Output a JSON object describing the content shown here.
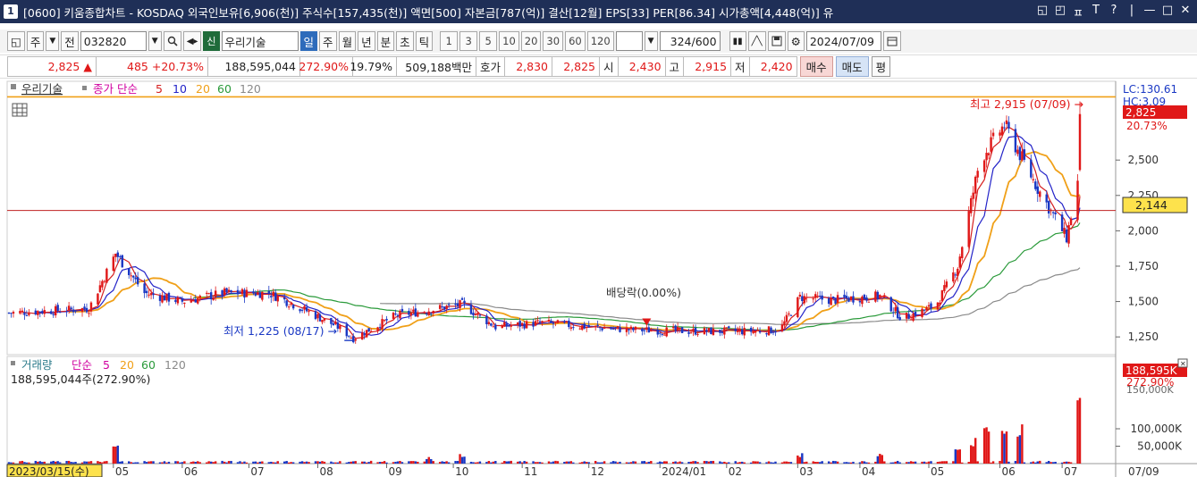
{
  "window": {
    "number": "1",
    "title": "[0600] 키움종합차트 - KOSDAQ 외국인보유[6,906(천)] 주식수[157,435(천)] 액면[500] 자본금[787(억)] 결산[12월] EPS[33] PER[86.34] 시가총액[4,448(억)] 유",
    "controls": [
      "◱",
      "◰",
      "ㅍ",
      "T",
      "?",
      "|",
      "—",
      "□",
      "✕"
    ]
  },
  "toolbar": {
    "period_unit": "주",
    "all": "전",
    "code": "032820",
    "stock_name": "우리기술",
    "sin_badge": "신",
    "periods": [
      "일",
      "주",
      "월",
      "년",
      "분",
      "초",
      "틱"
    ],
    "selected_period": "일",
    "intervals": [
      "1",
      "3",
      "5",
      "10",
      "20",
      "30",
      "60",
      "120"
    ],
    "count": "324",
    "count_total": "/600",
    "date": "2024/07/09"
  },
  "quote": {
    "price": "2,825",
    "arrow": "▲",
    "change": "485",
    "change_pct": "+20.73%",
    "volume": "188,595,044",
    "volume_ratio": "272.90%",
    "turnover": "19.79%",
    "amount": "509,188백만",
    "hoga_label": "호가",
    "ask": "2,830",
    "bid": "2,825",
    "open_label": "시",
    "open": "2,430",
    "high_label": "고",
    "high": "2,915",
    "low_label": "저",
    "low": "2,420",
    "buy": "매수",
    "sell": "매도",
    "flat": "평"
  },
  "price_panel": {
    "legend_stock": "우리기술",
    "legend_type": "종가 단순",
    "ma_periods": [
      "5",
      "10",
      "20",
      "60",
      "120"
    ],
    "lc_label": "LC:130.61",
    "hc_label": "HC:3.09",
    "current_price_badge": "2,825",
    "current_pct": "20.73%",
    "crosshair_price": "2,144",
    "high_annotation": "최고 2,915 (07/09) →",
    "low_annotation": "최저 1,225 (08/17) →",
    "dividend_annotation": "배당락(0.00%)",
    "y_ticks": [
      "2,500",
      "2,250",
      "2,000",
      "1,750",
      "1,500",
      "1,250"
    ]
  },
  "volume_panel": {
    "legend_title": "거래량",
    "legend_type": "단순",
    "ma_periods": [
      "5",
      "20",
      "60",
      "120"
    ],
    "current_volume": "188,595,044주(272.90%)",
    "badge": "188,595K",
    "badge_pct": "272.90%",
    "badge_under": "150,000K",
    "y_ticks": [
      "100,000K",
      "50,000K"
    ]
  },
  "x_axis": {
    "start_label": "2023/03/15(수)",
    "months": [
      "05",
      "06",
      "07",
      "08",
      "09",
      "10",
      "11",
      "12",
      "2024/01",
      "02",
      "03",
      "04",
      "05",
      "06",
      "07"
    ],
    "end_label": "07/09"
  },
  "colors": {
    "up": "#e01818",
    "down": "#1a38c4",
    "ma5": "#d62020",
    "ma10": "#2323c8",
    "ma20": "#f0a018",
    "ma60": "#2a9a3a",
    "ma120": "#8a8a8a"
  },
  "chart_data": {
    "type": "candlestick",
    "price_range": [
      1150,
      3000
    ],
    "high": {
      "value": 2915,
      "date": "07/09"
    },
    "low": {
      "value": 1225,
      "date": "08/17"
    },
    "close_series": [
      {
        "x": "2023/03/15",
        "y": 1420
      },
      {
        "x": "2023/04/20",
        "y": 1450
      },
      {
        "x": "2023/05/02",
        "y": 1840
      },
      {
        "x": "2023/05/15",
        "y": 1560
      },
      {
        "x": "2023/06/01",
        "y": 1500
      },
      {
        "x": "2023/06/20",
        "y": 1560
      },
      {
        "x": "2023/07/10",
        "y": 1560
      },
      {
        "x": "2023/07/25",
        "y": 1450
      },
      {
        "x": "2023/08/10",
        "y": 1320
      },
      {
        "x": "2023/08/17",
        "y": 1240
      },
      {
        "x": "2023/09/05",
        "y": 1400
      },
      {
        "x": "2023/09/20",
        "y": 1440
      },
      {
        "x": "2023/10/05",
        "y": 1480
      },
      {
        "x": "2023/10/20",
        "y": 1320
      },
      {
        "x": "2023/11/10",
        "y": 1350
      },
      {
        "x": "2023/12/01",
        "y": 1320
      },
      {
        "x": "2023/12/20",
        "y": 1300
      },
      {
        "x": "2024/01/15",
        "y": 1290
      },
      {
        "x": "2024/02/10",
        "y": 1290
      },
      {
        "x": "2024/02/25",
        "y": 1300
      },
      {
        "x": "2024/03/05",
        "y": 1530
      },
      {
        "x": "2024/03/20",
        "y": 1510
      },
      {
        "x": "2024/04/10",
        "y": 1540
      },
      {
        "x": "2024/04/20",
        "y": 1380
      },
      {
        "x": "2024/05/05",
        "y": 1470
      },
      {
        "x": "2024/05/15",
        "y": 1750
      },
      {
        "x": "2024/05/25",
        "y": 2500
      },
      {
        "x": "2024/06/05",
        "y": 2750
      },
      {
        "x": "2024/06/20",
        "y": 2300
      },
      {
        "x": "2024/07/03",
        "y": 1950
      },
      {
        "x": "2024/07/08",
        "y": 2340
      },
      {
        "x": "2024/07/09",
        "y": 2825
      }
    ],
    "volume_series_K": [
      {
        "x": "2023/05/02",
        "y": 60000
      },
      {
        "x": "2023/09/20",
        "y": 20000
      },
      {
        "x": "2023/10/05",
        "y": 30000
      },
      {
        "x": "2024/03/05",
        "y": 30000
      },
      {
        "x": "2024/04/10",
        "y": 35000
      },
      {
        "x": "2024/05/15",
        "y": 45000
      },
      {
        "x": "2024/05/22",
        "y": 80000
      },
      {
        "x": "2024/05/28",
        "y": 130000
      },
      {
        "x": "2024/06/05",
        "y": 135000
      },
      {
        "x": "2024/06/12",
        "y": 125000
      },
      {
        "x": "2024/07/08",
        "y": 40000
      },
      {
        "x": "2024/07/09",
        "y": 188595
      }
    ],
    "ylabel": "",
    "xlabel": ""
  }
}
